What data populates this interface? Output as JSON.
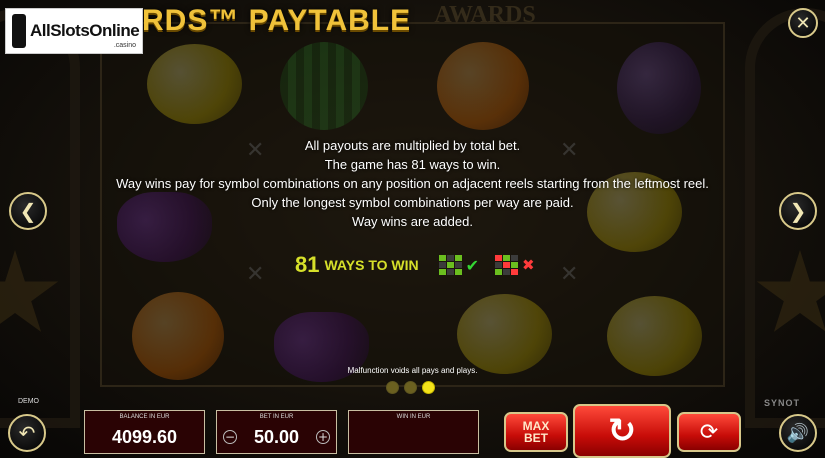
{
  "header": {
    "title": "RDS™ PAYTABLE",
    "ghost_logo": "AWARDS"
  },
  "brand": {
    "name": "AllSlotsOnline",
    "suffix": ".casino"
  },
  "icons": {
    "close": "close-icon",
    "prev": "chevron-left-icon",
    "next": "chevron-right-icon",
    "back": "undo-arrow-icon",
    "sound": "speaker-icon",
    "spin": "spin-arrow-icon",
    "autoplay": "autoplay-icon",
    "check": "checkmark-icon",
    "cross": "cross-icon"
  },
  "rules": [
    "All payouts are multiplied by total bet.",
    "The game has 81 ways to win.",
    "Way wins pay for symbol combinations on any position on adjacent reels starting from the leftmost reel.",
    "Only the longest symbol combinations per way are paid.",
    "Way wins are added."
  ],
  "ways": {
    "number": "81",
    "label": "WAYS TO WIN"
  },
  "footer_note": "Malfunction voids all pays and plays.",
  "pagination": {
    "pages": 3,
    "active": 3
  },
  "labels": {
    "demo": "DEMO",
    "provider": "SYNOT"
  },
  "panels": {
    "balance": {
      "label": "BALANCE IN EUR",
      "value": "4099.60"
    },
    "bet": {
      "label": "BET IN EUR",
      "value": "50.00",
      "minus": "−",
      "plus": "+"
    },
    "win": {
      "label": "WIN IN EUR",
      "value": ""
    }
  },
  "buttons": {
    "max_bet_line1": "MAX",
    "max_bet_line2": "BET"
  },
  "colors": {
    "accent_gold": "#f0c23a",
    "ways_yellow": "#d6e02a",
    "panel_red": "#2a0304",
    "button_red": "#c70c08",
    "check_green": "#34d634",
    "cross_red": "#ff3b3b"
  }
}
